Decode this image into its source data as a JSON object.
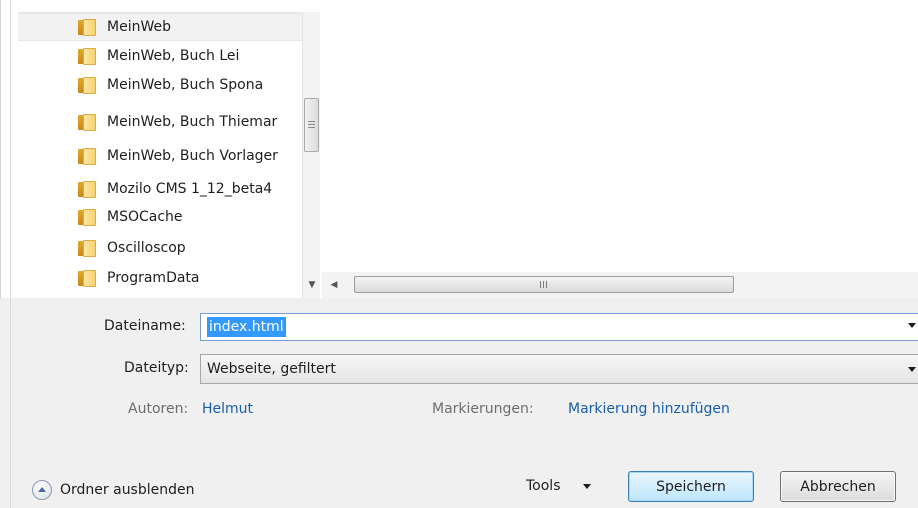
{
  "folders": [
    {
      "name": "MeinWeb",
      "selected": true
    },
    {
      "name": "MeinWeb, Buch Lei",
      "selected": false
    },
    {
      "name": "MeinWeb, Buch Spona",
      "selected": false
    },
    {
      "name": "MeinWeb, Buch Thiemar",
      "selected": false
    },
    {
      "name": "MeinWeb, Buch Vorlager",
      "selected": false
    },
    {
      "name": "Mozilo CMS 1_12_beta4",
      "selected": false
    },
    {
      "name": "MSOCache",
      "selected": false
    },
    {
      "name": "Oscilloscop",
      "selected": false
    },
    {
      "name": "ProgramData",
      "selected": false
    }
  ],
  "form": {
    "filename_label": "Dateiname:",
    "filename_value": "index.html",
    "filetype_label": "Dateityp:",
    "filetype_value": "Webseite, gefiltert",
    "authors_label": "Autoren:",
    "authors_value": "Helmut",
    "tags_label": "Markierungen:",
    "tags_value": "Markierung hinzufügen"
  },
  "footer": {
    "hide_folders_label": "Ordner ausblenden",
    "tools_label": "Tools",
    "save_label": "Speichern",
    "cancel_label": "Abbrechen"
  },
  "icons": {
    "folder": "folder-icon",
    "hide_folders": "chevron-up-circle-icon",
    "dropdown": "triangle-down-icon"
  },
  "colors": {
    "selection": "#3399ff",
    "link": "#1a5ea8",
    "save_button_border": "#3c7fb1",
    "folder_yellow": "#f6d270"
  }
}
